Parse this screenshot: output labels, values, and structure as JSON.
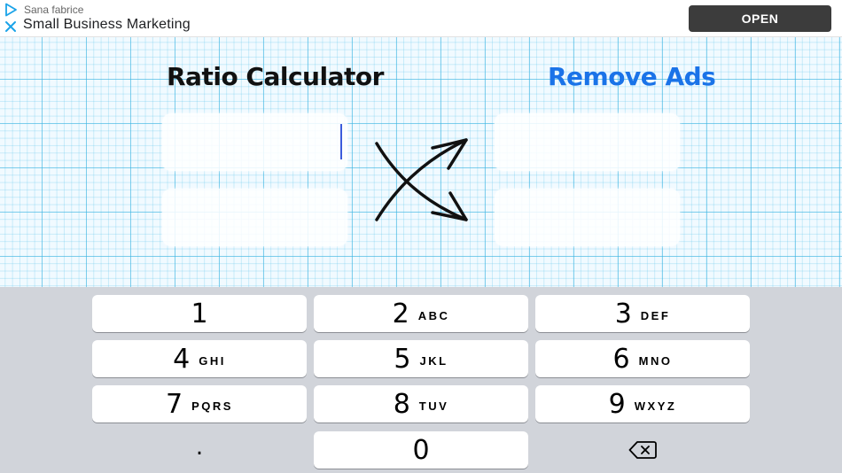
{
  "ad": {
    "sponsor": "Sana fabrice",
    "title": "Small Business Marketing",
    "open_label": "OPEN",
    "icons": [
      "play-icon",
      "close-icon"
    ]
  },
  "app": {
    "title": "Ratio Calculator",
    "remove_ads": "Remove Ads",
    "accent_color": "#1a73e8"
  },
  "fields": {
    "a": "",
    "b": "",
    "c": "",
    "d": ""
  },
  "keypad": {
    "keys": [
      {
        "num": "1",
        "letters": ""
      },
      {
        "num": "2",
        "letters": "ABC"
      },
      {
        "num": "3",
        "letters": "DEF"
      },
      {
        "num": "4",
        "letters": "GHI"
      },
      {
        "num": "5",
        "letters": "JKL"
      },
      {
        "num": "6",
        "letters": "MNO"
      },
      {
        "num": "7",
        "letters": "PQRS"
      },
      {
        "num": "8",
        "letters": "TUV"
      },
      {
        "num": "9",
        "letters": "WXYZ"
      },
      {
        "num": ".",
        "letters": ""
      },
      {
        "num": "0",
        "letters": ""
      }
    ],
    "backspace_icon": "backspace-icon"
  }
}
